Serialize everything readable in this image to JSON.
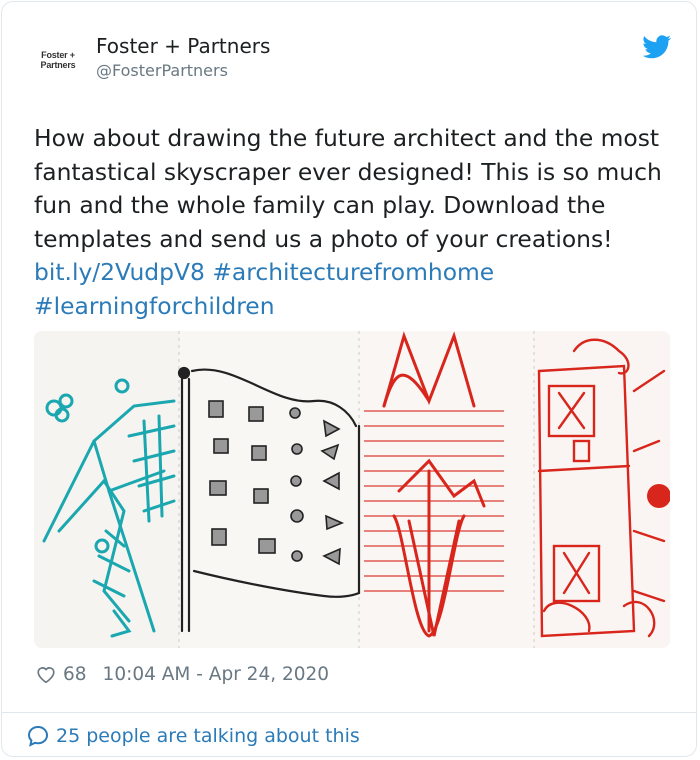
{
  "account": {
    "logo_line1": "Foster +",
    "logo_line2": "Partners",
    "name": "Foster + Partners",
    "handle": "@FosterPartners"
  },
  "tweet": {
    "text": "How about drawing the future architect and the most fantastical skyscraper ever designed! This is so much fun and the whole family can play. Download the templates and send us a photo of your creations!",
    "link": "bit.ly/2VudpV8",
    "hashtag1": "#architecturefromhome",
    "hashtag2": "#learningforchildren"
  },
  "footer": {
    "likes": "68",
    "timestamp": "10:04 AM - Apr 24, 2020",
    "talking": "25 people are talking about this"
  },
  "icons": {
    "avatar": "foster-partners-logo",
    "bird": "twitter-bird-icon",
    "heart": "heart-icon",
    "bubble": "speech-bubble-icon"
  },
  "colors": {
    "link": "#2b7bb9",
    "twitter_blue": "#1da1f2",
    "meta_gray": "#697882",
    "drawing_teal": "#1aa7b0",
    "drawing_red": "#d9261c"
  }
}
